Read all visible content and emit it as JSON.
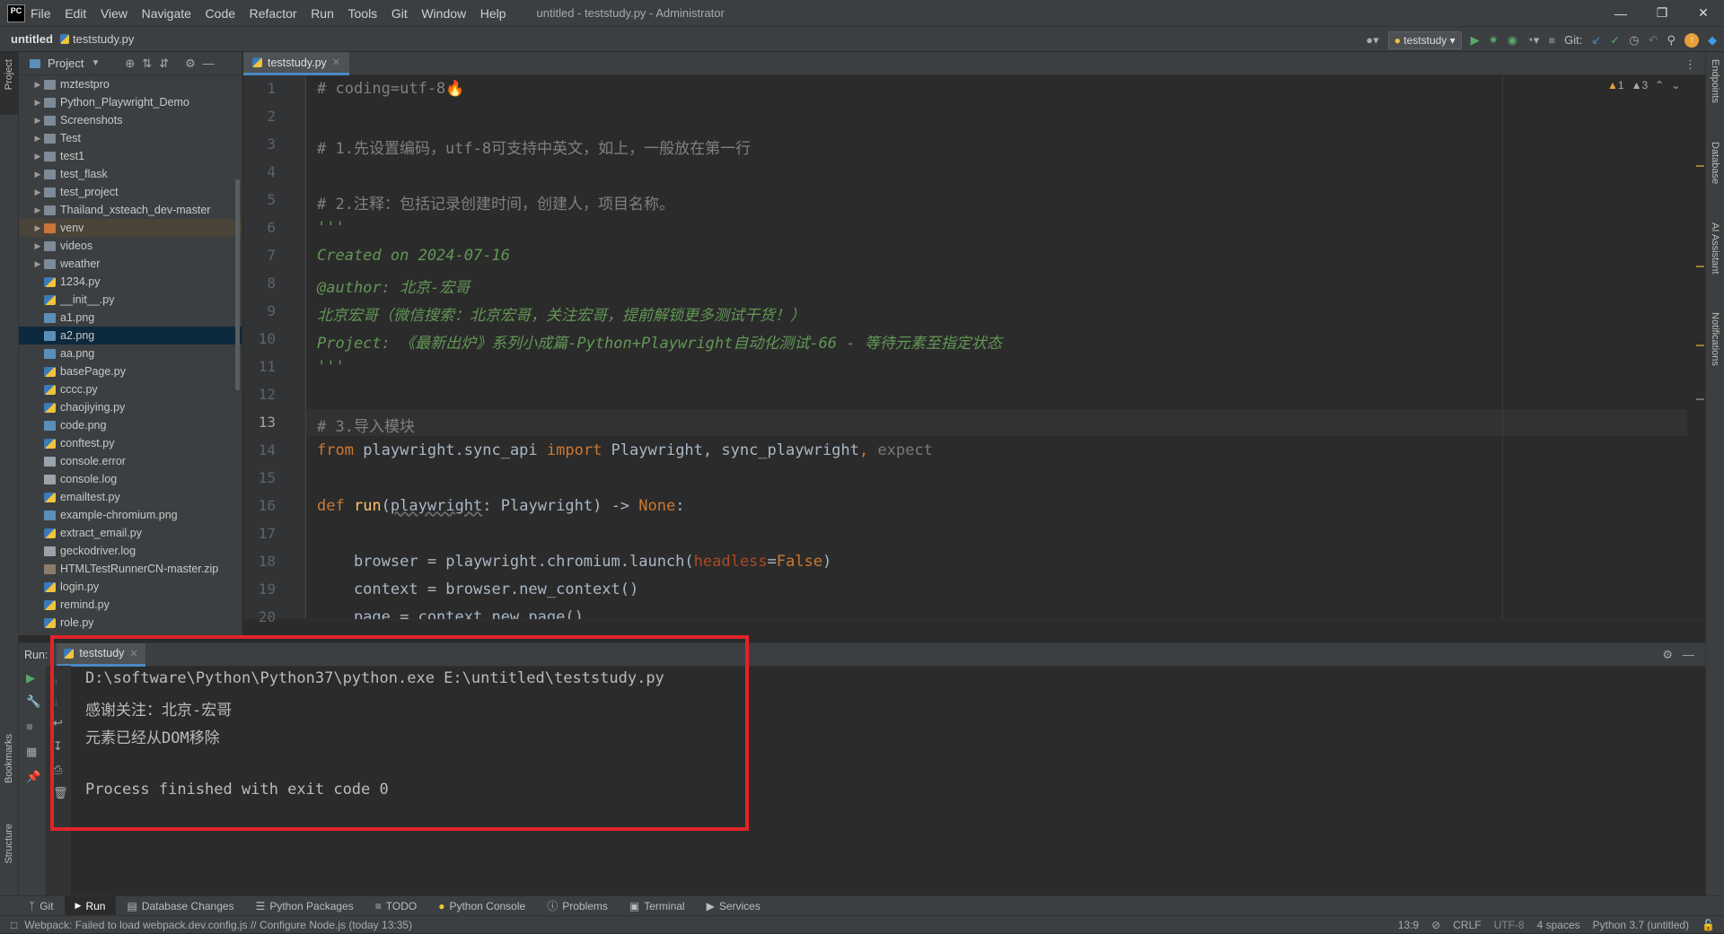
{
  "app": {
    "logo": "PC",
    "menu": [
      "File",
      "Edit",
      "View",
      "Navigate",
      "Code",
      "Refactor",
      "Run",
      "Tools",
      "Git",
      "Window",
      "Help"
    ],
    "window_title": "untitled - teststudy.py - Administrator"
  },
  "navbar": {
    "project": "untitled",
    "file": "teststudy.py",
    "run_config": "teststudy",
    "git_label": "Git:"
  },
  "left_strip": {
    "project": "Project",
    "bookmarks": "Bookmarks",
    "structure": "Structure"
  },
  "right_strip": {
    "endpoints": "Endpoints",
    "database": "Database",
    "ai": "AI Assistant",
    "notifications": "Notifications"
  },
  "project_panel": {
    "title": "Project",
    "items": [
      {
        "name": "mztestpro",
        "type": "folder"
      },
      {
        "name": "Python_Playwright_Demo",
        "type": "folder"
      },
      {
        "name": "Screenshots",
        "type": "folder"
      },
      {
        "name": "Test",
        "type": "folder"
      },
      {
        "name": "test1",
        "type": "folder"
      },
      {
        "name": "test_flask",
        "type": "folder"
      },
      {
        "name": "test_project",
        "type": "folder"
      },
      {
        "name": "Thailand_xsteach_dev-master",
        "type": "folder"
      },
      {
        "name": "venv",
        "type": "folder-orange"
      },
      {
        "name": "videos",
        "type": "folder"
      },
      {
        "name": "weather",
        "type": "folder"
      },
      {
        "name": "1234.py",
        "type": "py"
      },
      {
        "name": "__init__.py",
        "type": "py"
      },
      {
        "name": "a1.png",
        "type": "img"
      },
      {
        "name": "a2.png",
        "type": "img"
      },
      {
        "name": "aa.png",
        "type": "img"
      },
      {
        "name": "basePage.py",
        "type": "py"
      },
      {
        "name": "cccc.py",
        "type": "py"
      },
      {
        "name": "chaojiying.py",
        "type": "py"
      },
      {
        "name": "code.png",
        "type": "img"
      },
      {
        "name": "conftest.py",
        "type": "py"
      },
      {
        "name": "console.error",
        "type": "txt"
      },
      {
        "name": "console.log",
        "type": "txt"
      },
      {
        "name": "emailtest.py",
        "type": "py"
      },
      {
        "name": "example-chromium.png",
        "type": "img"
      },
      {
        "name": "extract_email.py",
        "type": "py"
      },
      {
        "name": "geckodriver.log",
        "type": "txt"
      },
      {
        "name": "HTMLTestRunnerCN-master.zip",
        "type": "zip"
      },
      {
        "name": "login.py",
        "type": "py"
      },
      {
        "name": "remind.py",
        "type": "py"
      },
      {
        "name": "role.py",
        "type": "py"
      }
    ],
    "selected": "a2.png",
    "highlighted": "venv"
  },
  "editor": {
    "tab": "teststudy.py",
    "warnings": "1",
    "weak_warnings": "3",
    "line_numbers": [
      "1",
      "2",
      "3",
      "4",
      "5",
      "6",
      "7",
      "8",
      "9",
      "10",
      "11",
      "12",
      "13",
      "14",
      "15",
      "16",
      "17",
      "18",
      "19",
      "20"
    ],
    "current_line": 13,
    "lines": {
      "l1": "# coding=utf-8",
      "l3": "# 1.先设置编码，utf-8可支持中英文，如上，一般放在第一行",
      "l5": "# 2.注释：包括记录创建时间，创建人，项目名称。",
      "l6": "'''",
      "l7": "Created on 2024-07-16",
      "l8": "@author: 北京-宏哥",
      "l9": "北京宏哥（微信搜索：北京宏哥，关注宏哥，提前解锁更多测试干货！）",
      "l10": "Project: 《最新出炉》系列小成篇-Python+Playwright自动化测试-66 - 等待元素至指定状态",
      "l11": "'''",
      "l13": "# 3.导入模块",
      "l14_from": "from",
      "l14_mod": " playwright.sync_api ",
      "l14_import": "import",
      "l14_names": " Playwright, sync_playwright",
      "l14_comma": ",",
      "l14_expect": " expect",
      "l16_def": "def ",
      "l16_fn": "run",
      "l16_open": "(",
      "l16_param": "playwright",
      "l16_rest": ": Playwright) -> ",
      "l16_none": "None",
      "l16_colon": ":",
      "l18_a": "    browser = playwright.chromium.launch(",
      "l18_param": "headless",
      "l18_eq": "=",
      "l18_false": "False",
      "l18_close": ")",
      "l19": "    context = browser.new_context()",
      "l20": "    page = context.new_page()"
    }
  },
  "run_panel": {
    "label": "Run:",
    "tab": "teststudy",
    "output": [
      "D:\\software\\Python\\Python37\\python.exe E:\\untitled\\teststudy.py",
      "感谢关注：北京-宏哥",
      "元素已经从DOM移除",
      "",
      "Process finished with exit code 0"
    ]
  },
  "tool_windows": [
    "Git",
    "Run",
    "Database Changes",
    "Python Packages",
    "TODO",
    "Python Console",
    "Problems",
    "Terminal",
    "Services"
  ],
  "status_bar": {
    "message": "Webpack: Failed to load webpack.dev.config.js // Configure Node.js (today 13:35)",
    "position": "13:9",
    "line_sep": "CRLF",
    "encoding": "UTF-8",
    "indent": "4 spaces",
    "interpreter": "Python 3.7 (untitled)"
  },
  "colors": {
    "accent": "#4a88c7",
    "highlight_box": "#e0242a"
  }
}
